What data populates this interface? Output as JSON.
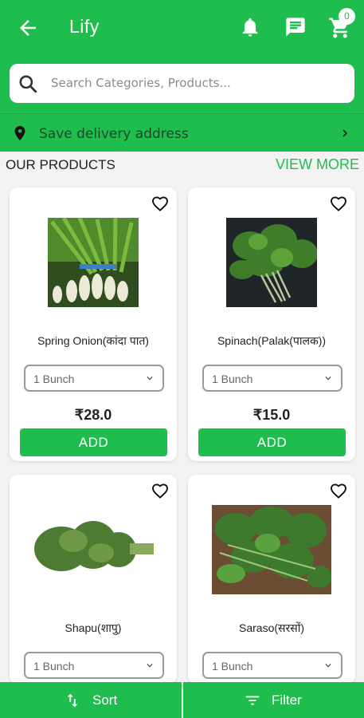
{
  "header": {
    "title": "Lify",
    "cart_count": "0"
  },
  "search": {
    "placeholder": "Search Categories, Products..."
  },
  "delivery": {
    "label": "Save delivery address"
  },
  "section": {
    "title": "OUR PRODUCTS",
    "view_more": "VIEW MORE"
  },
  "products": [
    {
      "name": "Spring Onion(कांदा पात)",
      "unit": "1 Bunch",
      "price": "₹28.0",
      "add_label": "ADD"
    },
    {
      "name": "Spinach(Palak(पालक))",
      "unit": "1 Bunch",
      "price": "₹15.0",
      "add_label": "ADD"
    },
    {
      "name": "Shapu(शापु)",
      "unit": "1 Bunch"
    },
    {
      "name": "Saraso(सरसों)",
      "unit": "1 Bunch"
    }
  ],
  "bottom": {
    "sort_label": "Sort",
    "filter_label": "Filter"
  },
  "colors": {
    "brand": "#1ebd4e",
    "background": "#f2f2f2"
  },
  "icons": [
    "back-arrow-icon",
    "bell-icon",
    "chat-icon",
    "cart-icon",
    "search-icon",
    "location-pin-icon",
    "chevron-right-icon",
    "heart-icon",
    "chevron-down-icon",
    "sort-icon",
    "filter-icon"
  ]
}
